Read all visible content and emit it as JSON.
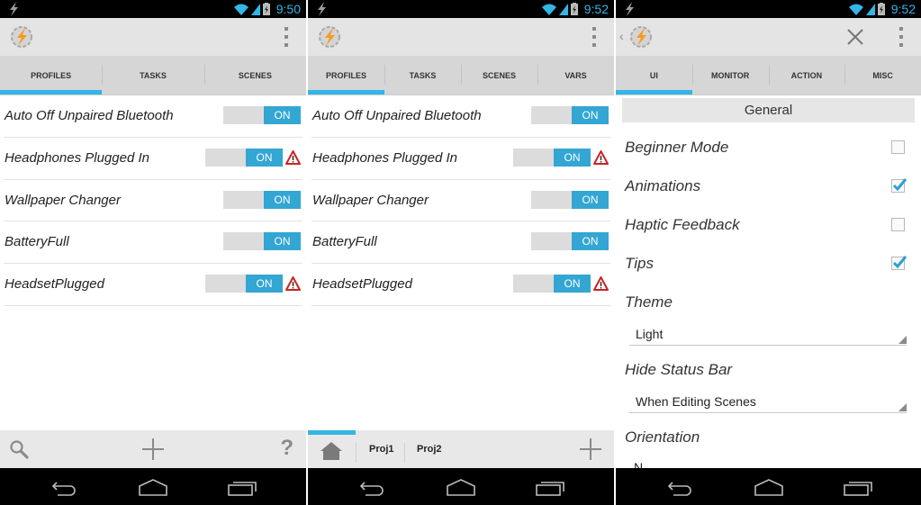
{
  "colors": {
    "accent": "#33b5e5",
    "toggle_on": "#33a6d3",
    "warning": "#cc2222",
    "statusbar": "#000000",
    "actionbar": "#e4e4e4"
  },
  "screens": [
    {
      "status": {
        "time": "9:50"
      },
      "tabs": [
        {
          "label": "PROFILES",
          "active": true
        },
        {
          "label": "TASKS",
          "active": false
        },
        {
          "label": "SCENES",
          "active": false
        }
      ],
      "profiles": [
        {
          "name": "Auto Off Unpaired Bluetooth",
          "toggle": "ON",
          "warning": false
        },
        {
          "name": "Headphones Plugged In",
          "toggle": "ON",
          "warning": true
        },
        {
          "name": "Wallpaper Changer",
          "toggle": "ON",
          "warning": false
        },
        {
          "name": "BatteryFull",
          "toggle": "ON",
          "warning": false
        },
        {
          "name": "HeadsetPlugged",
          "toggle": "ON",
          "warning": true
        }
      ],
      "bottombar": {
        "left_icon": "search-icon",
        "center_icon": "add-icon",
        "right_label": "?"
      }
    },
    {
      "status": {
        "time": "9:52"
      },
      "tabs": [
        {
          "label": "PROFILES",
          "active": true
        },
        {
          "label": "TASKS",
          "active": false
        },
        {
          "label": "SCENES",
          "active": false
        },
        {
          "label": "VARS",
          "active": false
        }
      ],
      "profiles": [
        {
          "name": "Auto Off Unpaired Bluetooth",
          "toggle": "ON",
          "warning": false
        },
        {
          "name": "Headphones Plugged In",
          "toggle": "ON",
          "warning": true
        },
        {
          "name": "Wallpaper Changer",
          "toggle": "ON",
          "warning": false
        },
        {
          "name": "BatteryFull",
          "toggle": "ON",
          "warning": false
        },
        {
          "name": "HeadsetPlugged",
          "toggle": "ON",
          "warning": true
        }
      ],
      "projects": {
        "home_icon": "home-icon",
        "tabs": [
          "Proj1",
          "Proj2"
        ],
        "add_icon": "add-icon"
      }
    },
    {
      "status": {
        "time": "9:52"
      },
      "tabs": [
        {
          "label": "UI",
          "active": true
        },
        {
          "label": "MONITOR",
          "active": false
        },
        {
          "label": "ACTION",
          "active": false
        },
        {
          "label": "MISC",
          "active": false
        }
      ],
      "section_header": "General",
      "checkbox_prefs": [
        {
          "label": "Beginner Mode",
          "checked": false
        },
        {
          "label": "Animations",
          "checked": true
        },
        {
          "label": "Haptic Feedback",
          "checked": false
        },
        {
          "label": "Tips",
          "checked": true
        }
      ],
      "select_prefs": [
        {
          "label": "Theme",
          "value": "Light"
        },
        {
          "label": "Hide Status Bar",
          "value": "When Editing Scenes"
        },
        {
          "label": "Orientation",
          "value": "N..."
        }
      ]
    }
  ]
}
